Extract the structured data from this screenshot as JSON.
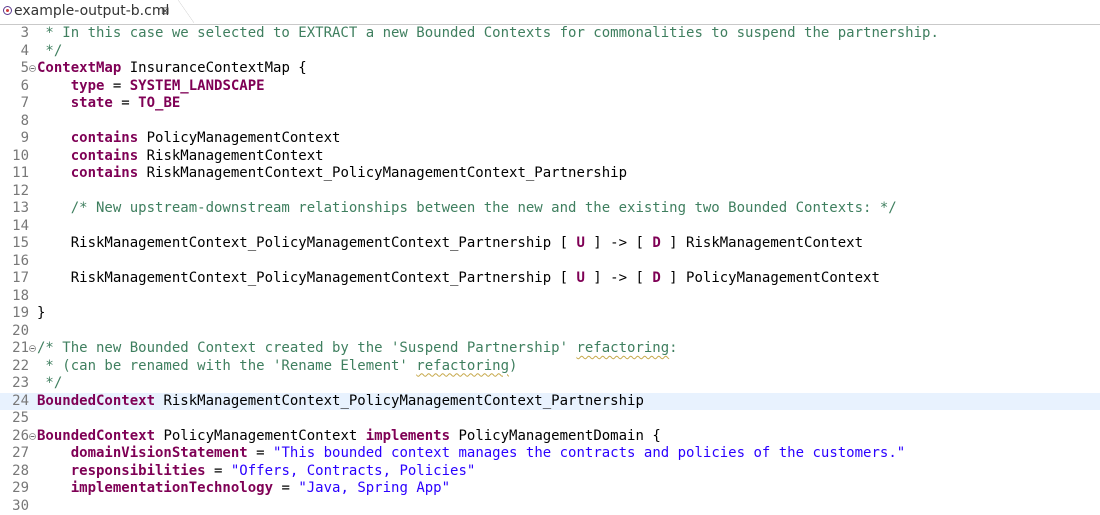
{
  "tab": {
    "title": "example-output-b.cml",
    "close_icon": "close-icon",
    "file_icon": "cml-file-icon"
  },
  "colors": {
    "keyword": "#7f0055",
    "comment": "#3f7f5f",
    "string": "#2a00ff",
    "line_number": "#787878",
    "current_line": "#e8f2fe"
  },
  "editor": {
    "current_line": 24,
    "folded_lines": [
      5,
      21,
      26
    ],
    "lines": [
      {
        "n": "3",
        "tokens": [
          {
            "t": "comment",
            "v": " * In this case we selected to EXTRACT a new Bounded Contexts for commonalities to suspend the partnership."
          }
        ]
      },
      {
        "n": "4",
        "tokens": [
          {
            "t": "comment",
            "v": " */"
          }
        ]
      },
      {
        "n": "5",
        "tokens": [
          {
            "t": "kw",
            "v": "ContextMap"
          },
          {
            "t": "text",
            "v": " InsuranceContextMap {"
          }
        ]
      },
      {
        "n": "6",
        "tokens": [
          {
            "t": "text",
            "v": "    "
          },
          {
            "t": "kw",
            "v": "type"
          },
          {
            "t": "text",
            "v": " = "
          },
          {
            "t": "kw",
            "v": "SYSTEM_LANDSCAPE"
          }
        ]
      },
      {
        "n": "7",
        "tokens": [
          {
            "t": "text",
            "v": "    "
          },
          {
            "t": "kw",
            "v": "state"
          },
          {
            "t": "text",
            "v": " = "
          },
          {
            "t": "kw",
            "v": "TO_BE"
          }
        ]
      },
      {
        "n": "8",
        "tokens": []
      },
      {
        "n": "9",
        "tokens": [
          {
            "t": "text",
            "v": "    "
          },
          {
            "t": "kw",
            "v": "contains"
          },
          {
            "t": "text",
            "v": " PolicyManagementContext"
          }
        ]
      },
      {
        "n": "10",
        "tokens": [
          {
            "t": "text",
            "v": "    "
          },
          {
            "t": "kw",
            "v": "contains"
          },
          {
            "t": "text",
            "v": " RiskManagementContext"
          }
        ]
      },
      {
        "n": "11",
        "tokens": [
          {
            "t": "text",
            "v": "    "
          },
          {
            "t": "kw",
            "v": "contains"
          },
          {
            "t": "text",
            "v": " RiskManagementContext_PolicyManagementContext_Partnership"
          }
        ]
      },
      {
        "n": "12",
        "tokens": []
      },
      {
        "n": "13",
        "tokens": [
          {
            "t": "text",
            "v": "    "
          },
          {
            "t": "comment",
            "v": "/* New upstream-downstream relationships between the new and the existing two Bounded Contexts: */"
          }
        ]
      },
      {
        "n": "14",
        "tokens": []
      },
      {
        "n": "15",
        "tokens": [
          {
            "t": "text",
            "v": "    RiskManagementContext_PolicyManagementContext_Partnership [ "
          },
          {
            "t": "kw",
            "v": "U"
          },
          {
            "t": "text",
            "v": " ] -> [ "
          },
          {
            "t": "kw",
            "v": "D"
          },
          {
            "t": "text",
            "v": " ] RiskManagementContext"
          }
        ]
      },
      {
        "n": "16",
        "tokens": []
      },
      {
        "n": "17",
        "tokens": [
          {
            "t": "text",
            "v": "    RiskManagementContext_PolicyManagementContext_Partnership [ "
          },
          {
            "t": "kw",
            "v": "U"
          },
          {
            "t": "text",
            "v": " ] -> [ "
          },
          {
            "t": "kw",
            "v": "D"
          },
          {
            "t": "text",
            "v": " ] PolicyManagementContext"
          }
        ]
      },
      {
        "n": "18",
        "tokens": []
      },
      {
        "n": "19",
        "tokens": [
          {
            "t": "text",
            "v": "}"
          }
        ]
      },
      {
        "n": "20",
        "tokens": []
      },
      {
        "n": "21",
        "tokens": [
          {
            "t": "comment",
            "v": "/* The new Bounded Context created by the 'Suspend Partnership' "
          },
          {
            "t": "comment-squiggle",
            "v": "refactoring"
          },
          {
            "t": "comment",
            "v": ":"
          }
        ]
      },
      {
        "n": "22",
        "tokens": [
          {
            "t": "comment",
            "v": " * (can be renamed with the 'Rename Element' "
          },
          {
            "t": "comment-squiggle",
            "v": "refactoring"
          },
          {
            "t": "comment",
            "v": ")"
          }
        ]
      },
      {
        "n": "23",
        "tokens": [
          {
            "t": "comment",
            "v": " */"
          }
        ]
      },
      {
        "n": "24",
        "tokens": [
          {
            "t": "kw",
            "v": "BoundedContext"
          },
          {
            "t": "text",
            "v": " RiskManagementContext_PolicyManagementContext_Partnership"
          }
        ]
      },
      {
        "n": "25",
        "tokens": []
      },
      {
        "n": "26",
        "tokens": [
          {
            "t": "kw",
            "v": "BoundedContext"
          },
          {
            "t": "text",
            "v": " PolicyManagementContext "
          },
          {
            "t": "kw",
            "v": "implements"
          },
          {
            "t": "text",
            "v": " PolicyManagementDomain {"
          }
        ]
      },
      {
        "n": "27",
        "tokens": [
          {
            "t": "text",
            "v": "    "
          },
          {
            "t": "kw",
            "v": "domainVisionStatement"
          },
          {
            "t": "text",
            "v": " = "
          },
          {
            "t": "string",
            "v": "\"This bounded context manages the contracts and policies of the customers.\""
          }
        ]
      },
      {
        "n": "28",
        "tokens": [
          {
            "t": "text",
            "v": "    "
          },
          {
            "t": "kw",
            "v": "responsibilities"
          },
          {
            "t": "text",
            "v": " = "
          },
          {
            "t": "string",
            "v": "\"Offers, Contracts, Policies\""
          }
        ]
      },
      {
        "n": "29",
        "tokens": [
          {
            "t": "text",
            "v": "    "
          },
          {
            "t": "kw",
            "v": "implementationTechnology"
          },
          {
            "t": "text",
            "v": " = "
          },
          {
            "t": "string",
            "v": "\"Java, Spring App\""
          }
        ]
      },
      {
        "n": "30",
        "tokens": []
      }
    ]
  }
}
